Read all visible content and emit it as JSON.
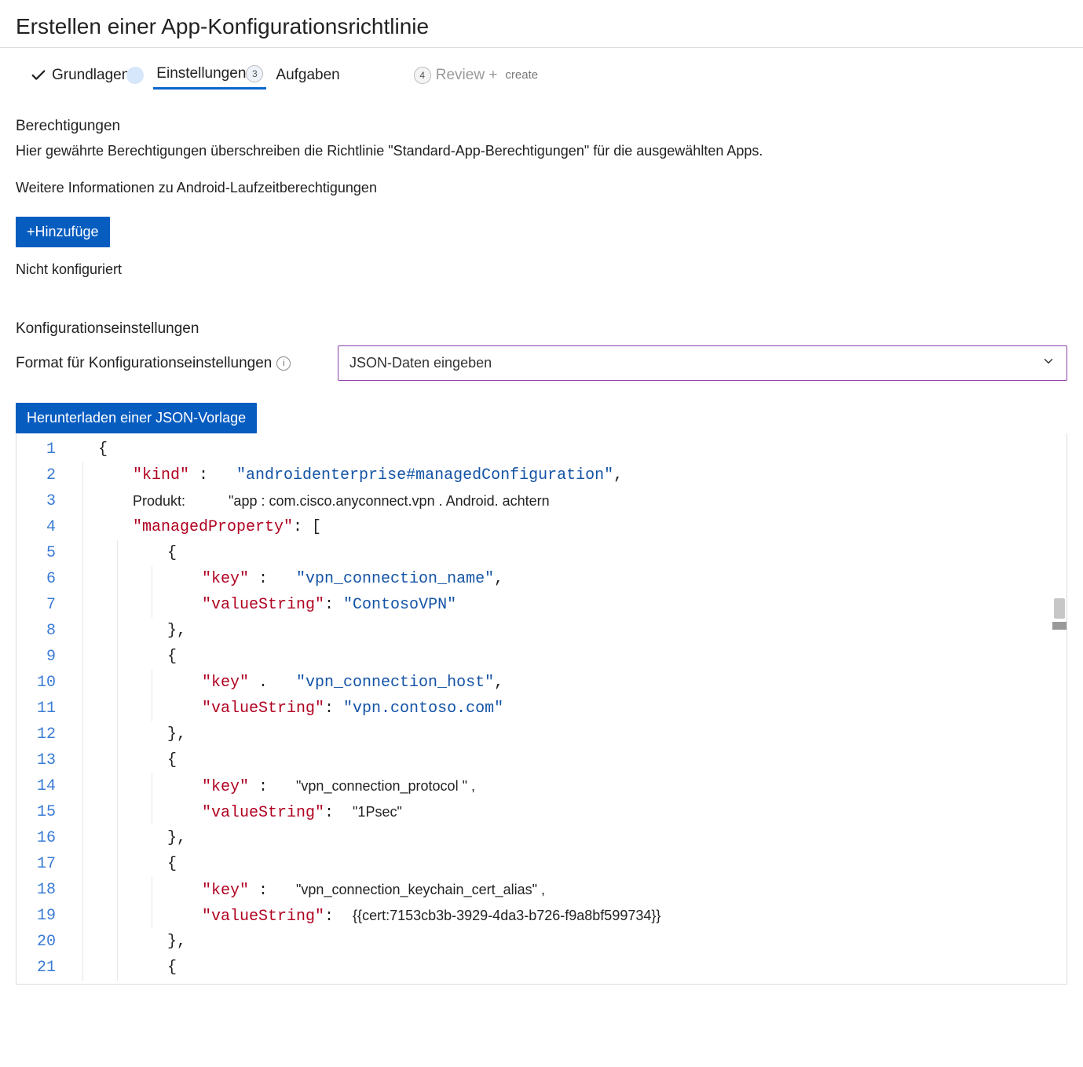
{
  "page_title": "Erstellen einer App-Konfigurationsrichtlinie",
  "steps": {
    "one": {
      "label": "Grundlagen"
    },
    "two": {
      "label": "Einstellungen",
      "badge": "3"
    },
    "three": {
      "label": "Aufgaben"
    },
    "four": {
      "label": "Review +",
      "sublabel": "create",
      "badge": "4"
    }
  },
  "permissions": {
    "heading": "Berechtigungen",
    "desc": "Hier gewährte Berechtigungen überschreiben die Richtlinie \"Standard-App-Berechtigungen\" für die ausgewählten Apps.",
    "more_info": "Weitere Informationen zu Android-Laufzeitberechtigungen",
    "add_button": "+Hinzufüge",
    "status": "Nicht konfiguriert"
  },
  "config": {
    "heading": "Konfigurationseinstellungen",
    "format_label": "Format für Konfigurationseinstellungen",
    "dropdown_value": "JSON-Daten eingeben",
    "download_button": "Herunterladen einer JSON-Vorlage"
  },
  "editor_lines": [
    {
      "n": 1,
      "indent": 1,
      "segs": [
        {
          "cls": "tok-brace",
          "t": "{"
        }
      ]
    },
    {
      "n": 2,
      "indent": 2,
      "segs": [
        {
          "cls": "tok-key",
          "t": "\"kind\""
        },
        {
          "cls": "tok-punc",
          "t": " :   "
        },
        {
          "cls": "tok-str",
          "t": "\"androidenterprise#managedConfiguration\""
        },
        {
          "cls": "tok-punc",
          "t": ","
        }
      ]
    },
    {
      "n": 3,
      "indent": 2,
      "segs": [
        {
          "cls": "tok-plain",
          "t": "Produkt:           \"app : com.cisco.anyconnect.vpn . Android. achtern"
        }
      ]
    },
    {
      "n": 4,
      "indent": 2,
      "segs": [
        {
          "cls": "tok-key",
          "t": "\"managedProperty\""
        },
        {
          "cls": "tok-punc",
          "t": ": ["
        }
      ]
    },
    {
      "n": 5,
      "indent": 3,
      "segs": [
        {
          "cls": "tok-brace",
          "t": "{"
        }
      ]
    },
    {
      "n": 6,
      "indent": 4,
      "segs": [
        {
          "cls": "tok-key",
          "t": "\"key\""
        },
        {
          "cls": "tok-punc",
          "t": " :   "
        },
        {
          "cls": "tok-str",
          "t": "\"vpn_connection_name\""
        },
        {
          "cls": "tok-punc",
          "t": ","
        }
      ]
    },
    {
      "n": 7,
      "indent": 4,
      "segs": [
        {
          "cls": "tok-key",
          "t": "\"valueString\""
        },
        {
          "cls": "tok-punc",
          "t": ": "
        },
        {
          "cls": "tok-str",
          "t": "\"ContosoVPN\""
        }
      ]
    },
    {
      "n": 8,
      "indent": 3,
      "segs": [
        {
          "cls": "tok-brace",
          "t": "},"
        }
      ]
    },
    {
      "n": 9,
      "indent": 3,
      "segs": [
        {
          "cls": "tok-brace",
          "t": "{"
        }
      ]
    },
    {
      "n": 10,
      "indent": 4,
      "segs": [
        {
          "cls": "tok-key",
          "t": "\"key\""
        },
        {
          "cls": "tok-punc",
          "t": " .   "
        },
        {
          "cls": "tok-str",
          "t": "\"vpn_connection_host\""
        },
        {
          "cls": "tok-punc",
          "t": ","
        }
      ]
    },
    {
      "n": 11,
      "indent": 4,
      "segs": [
        {
          "cls": "tok-key",
          "t": "\"valueString\""
        },
        {
          "cls": "tok-punc",
          "t": ": "
        },
        {
          "cls": "tok-str",
          "t": "\"vpn.contoso.com\""
        }
      ]
    },
    {
      "n": 12,
      "indent": 3,
      "segs": [
        {
          "cls": "tok-brace",
          "t": "},"
        }
      ]
    },
    {
      "n": 13,
      "indent": 3,
      "segs": [
        {
          "cls": "tok-brace",
          "t": "{"
        }
      ]
    },
    {
      "n": 14,
      "indent": 4,
      "segs": [
        {
          "cls": "tok-key",
          "t": "\"key\""
        },
        {
          "cls": "tok-punc",
          "t": " :   "
        },
        {
          "cls": "tok-plain",
          "t": "\"vpn_connection_protocol \" ,"
        }
      ]
    },
    {
      "n": 15,
      "indent": 4,
      "segs": [
        {
          "cls": "tok-key",
          "t": "\"valueString\""
        },
        {
          "cls": "tok-punc",
          "t": ":  "
        },
        {
          "cls": "tok-plain",
          "t": "\"1Psec\""
        }
      ]
    },
    {
      "n": 16,
      "indent": 3,
      "segs": [
        {
          "cls": "tok-brace",
          "t": "},"
        }
      ]
    },
    {
      "n": 17,
      "indent": 3,
      "segs": [
        {
          "cls": "tok-brace",
          "t": "{"
        }
      ]
    },
    {
      "n": 18,
      "indent": 4,
      "segs": [
        {
          "cls": "tok-key",
          "t": "\"key\""
        },
        {
          "cls": "tok-punc",
          "t": " :   "
        },
        {
          "cls": "tok-plain",
          "t": "\"vpn_connection_keychain_cert_alias\" ,"
        }
      ]
    },
    {
      "n": 19,
      "indent": 4,
      "segs": [
        {
          "cls": "tok-key",
          "t": "\"valueString\""
        },
        {
          "cls": "tok-punc",
          "t": ":  "
        },
        {
          "cls": "tok-plain",
          "t": "{{cert:7153cb3b-3929-4da3-b726-f9a8bf599734}}"
        }
      ]
    },
    {
      "n": 20,
      "indent": 3,
      "segs": [
        {
          "cls": "tok-brace",
          "t": "},"
        }
      ]
    },
    {
      "n": 21,
      "indent": 3,
      "segs": [
        {
          "cls": "tok-brace",
          "t": "{"
        }
      ]
    }
  ]
}
